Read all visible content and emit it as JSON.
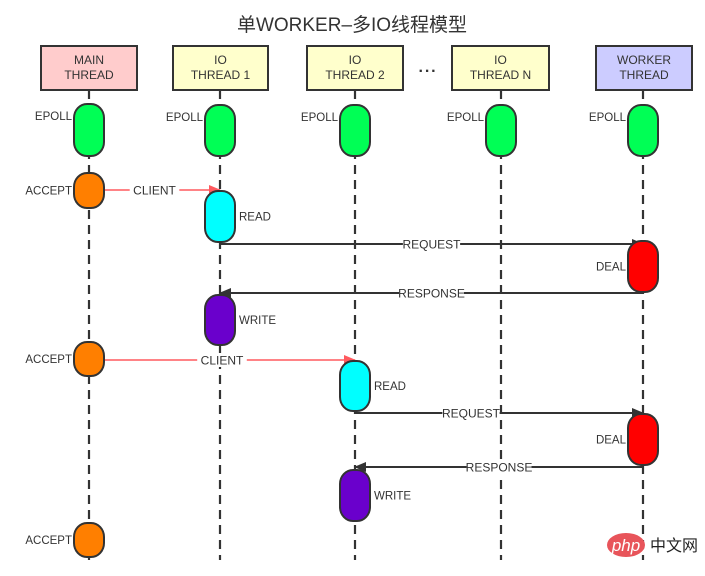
{
  "title": "单WORKER–多IO线程模型",
  "threads": [
    {
      "id": "main",
      "lines": [
        "MAIN",
        "THREAD"
      ],
      "color": "#ffcccc"
    },
    {
      "id": "io1",
      "lines": [
        "IO",
        "THREAD 1"
      ],
      "color": "#ffffcc"
    },
    {
      "id": "io2",
      "lines": [
        "IO",
        "THREAD 2"
      ],
      "color": "#ffffcc"
    },
    {
      "id": "ion",
      "lines": [
        "IO",
        "THREAD N"
      ],
      "color": "#ffffcc"
    },
    {
      "id": "worker",
      "lines": [
        "WORKER",
        "THREAD"
      ],
      "color": "#ccccff"
    }
  ],
  "ellipsis": "···",
  "activations": [
    {
      "thread": "main",
      "label": "EPOLL",
      "type": "epoll",
      "label_side": "left"
    },
    {
      "thread": "io1",
      "label": "EPOLL",
      "type": "epoll",
      "label_side": "left"
    },
    {
      "thread": "io2",
      "label": "EPOLL",
      "type": "epoll",
      "label_side": "left"
    },
    {
      "thread": "ion",
      "label": "EPOLL",
      "type": "epoll",
      "label_side": "left"
    },
    {
      "thread": "worker",
      "label": "EPOLL",
      "type": "epoll",
      "label_side": "left"
    },
    {
      "thread": "main",
      "label": "ACCEPT",
      "type": "accept",
      "label_side": "left"
    },
    {
      "thread": "io1",
      "label": "READ",
      "type": "read",
      "label_side": "right"
    },
    {
      "thread": "worker",
      "label": "DEAL",
      "type": "deal",
      "label_side": "left"
    },
    {
      "thread": "io1",
      "label": "WRITE",
      "type": "write",
      "label_side": "right"
    },
    {
      "thread": "main",
      "label": "ACCEPT",
      "type": "accept",
      "label_side": "left"
    },
    {
      "thread": "io2",
      "label": "READ",
      "type": "read",
      "label_side": "right"
    },
    {
      "thread": "worker",
      "label": "DEAL",
      "type": "deal",
      "label_side": "left"
    },
    {
      "thread": "io2",
      "label": "WRITE",
      "type": "write",
      "label_side": "right"
    },
    {
      "thread": "main",
      "label": "ACCEPT",
      "type": "accept",
      "label_side": "left"
    }
  ],
  "messages": [
    {
      "from": "main",
      "to": "io1",
      "label": "CLIENT",
      "kind": "client"
    },
    {
      "from": "io1",
      "to": "worker",
      "label": "REQUEST",
      "kind": "request"
    },
    {
      "from": "worker",
      "to": "io1",
      "label": "RESPONSE",
      "kind": "response"
    },
    {
      "from": "main",
      "to": "io2",
      "label": "CLIENT",
      "kind": "client"
    },
    {
      "from": "io2",
      "to": "worker",
      "label": "REQUEST",
      "kind": "request"
    },
    {
      "from": "worker",
      "to": "io2",
      "label": "RESPONSE",
      "kind": "response"
    }
  ],
  "colors": {
    "epoll": "#00ff55",
    "accept": "#ff7f00",
    "read": "#00ffff",
    "deal": "#ff0000",
    "write": "#6a00cc",
    "client_arrow": "#ff5a5f",
    "arrow": "#333333",
    "border": "#333333",
    "watermark": "#e8545a"
  },
  "watermark": {
    "logo": "php",
    "text": "中文网"
  }
}
